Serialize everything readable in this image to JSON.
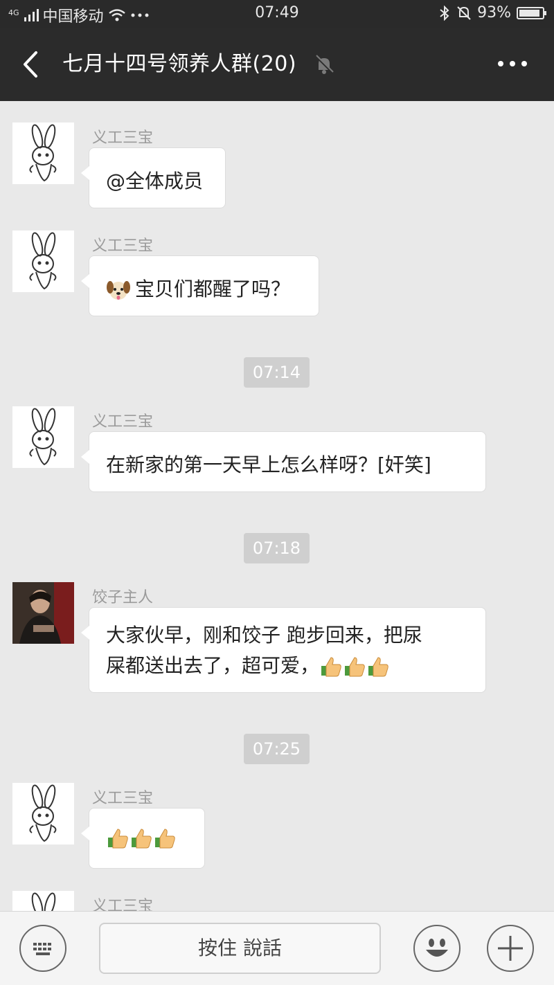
{
  "status": {
    "network": "4G",
    "carrier": "中国移动",
    "time": "07:49",
    "battery": "93%",
    "battery_level": 0.93
  },
  "header": {
    "title": "七月十四号领养人群(20)",
    "back_icon": "chevron-left-icon",
    "mute_icon": "bell-muted-icon",
    "more_icon": "more-dots-icon"
  },
  "messages": [
    {
      "sender": "义工三宝",
      "text": "@全体成员"
    },
    {
      "sender": "义工三宝",
      "text": "宝贝们都醒了吗？",
      "emoji": "dog-face-emoji"
    },
    {
      "time": "07:14"
    },
    {
      "sender": "义工三宝",
      "text": "在新家的第一天早上怎么样呀？[奸笑]"
    },
    {
      "time": "07:18"
    },
    {
      "sender": "饺子主人",
      "line1": "大家伙早，刚和饺子 跑步回来，把尿",
      "line2": "屎都送出去了，超可爱，",
      "emoji": "thumbs-up-emoji"
    },
    {
      "time": "07:25"
    },
    {
      "sender": "义工三宝",
      "emoji": "thumbs-up-emoji"
    },
    {
      "sender": "义工三宝"
    }
  ],
  "input": {
    "talk_label": "按住 說話",
    "keyboard_icon": "keyboard-icon",
    "emoji_icon": "smiley-icon",
    "plus_icon": "plus-icon"
  }
}
